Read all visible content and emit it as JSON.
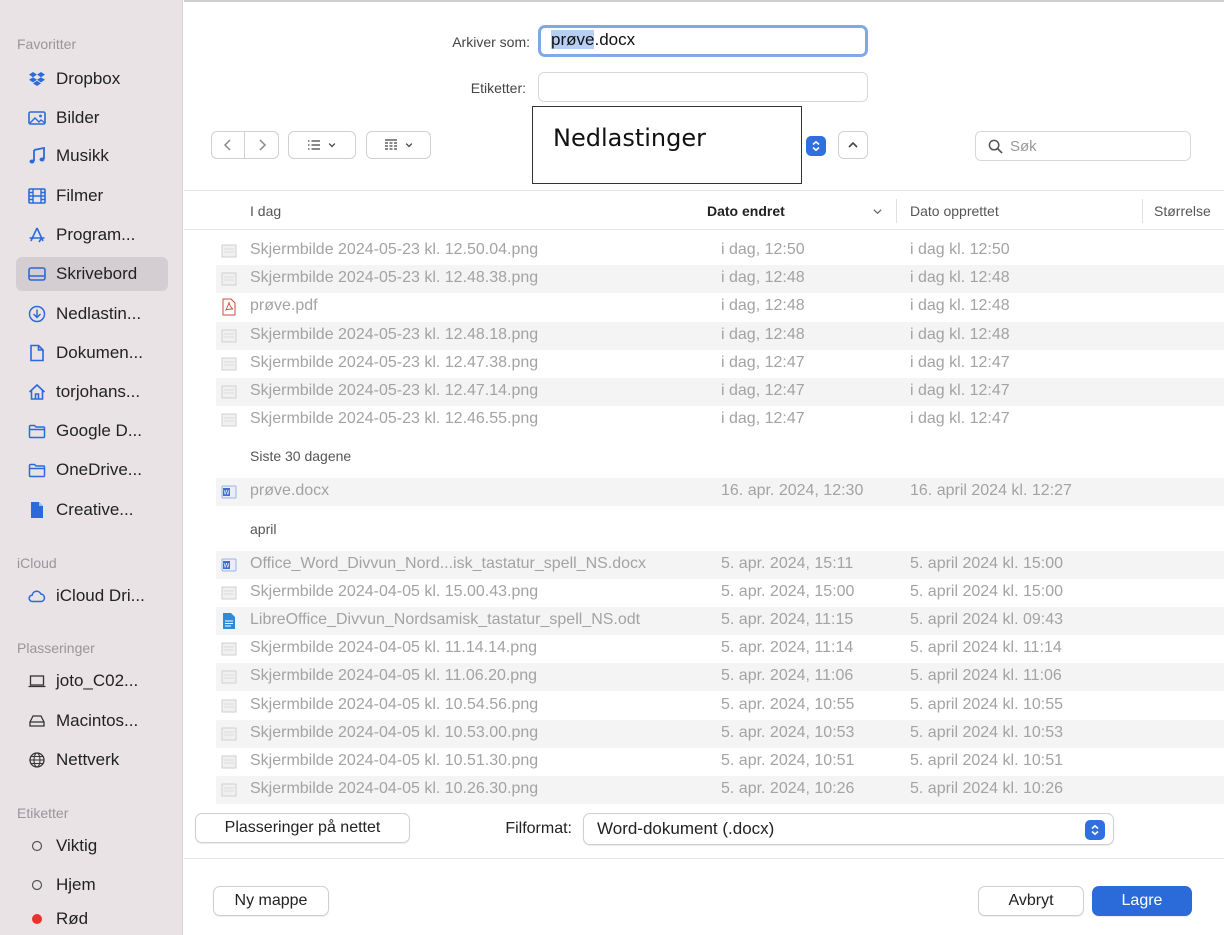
{
  "sidebar": {
    "sections": {
      "favorites": "Favoritter",
      "icloud": "iCloud",
      "locations": "Plasseringer",
      "tags": "Etiketter"
    },
    "favorites": [
      {
        "label": "Dropbox",
        "icon": "dropbox-icon"
      },
      {
        "label": "Bilder",
        "icon": "photos-icon"
      },
      {
        "label": "Musikk",
        "icon": "music-icon"
      },
      {
        "label": "Filmer",
        "icon": "film-icon"
      },
      {
        "label": "Program...",
        "icon": "applications-icon"
      },
      {
        "label": "Skrivebord",
        "icon": "desktop-icon",
        "selected": true
      },
      {
        "label": "Nedlastin...",
        "icon": "downloads-icon"
      },
      {
        "label": "Dokumen...",
        "icon": "document-icon"
      },
      {
        "label": "torjohans...",
        "icon": "home-icon"
      },
      {
        "label": "Google D...",
        "icon": "folder-icon"
      },
      {
        "label": "OneDrive...",
        "icon": "folder-icon"
      },
      {
        "label": "Creative...",
        "icon": "file-icon"
      }
    ],
    "icloud": [
      {
        "label": "iCloud Dri...",
        "icon": "cloud-icon"
      }
    ],
    "locations": [
      {
        "label": "joto_C02...",
        "icon": "laptop-icon"
      },
      {
        "label": "Macintos...",
        "icon": "disk-icon"
      },
      {
        "label": "Nettverk",
        "icon": "globe-icon"
      }
    ],
    "tags": [
      {
        "label": "Viktig",
        "color": ""
      },
      {
        "label": "Hjem",
        "color": ""
      },
      {
        "label": "Rød",
        "color": "#e8322b"
      }
    ]
  },
  "form": {
    "save_as_label": "Arkiver som:",
    "filename_selected": "prøve",
    "filename_ext": ".docx",
    "tags_label": "Etiketter:",
    "tags_value": ""
  },
  "toolbar": {
    "location": "Nedlastinger",
    "search_placeholder": "Søk"
  },
  "table": {
    "columns": {
      "name": "I dag",
      "modified": "Dato endret",
      "created": "Dato opprettet",
      "size": "Størrelse"
    },
    "groups": [
      {
        "title": "",
        "rows": [
          {
            "name": "Skjermbilde 2024-05-23 kl. 12.50.04.png",
            "modified": "i dag, 12:50",
            "created": "i dag kl. 12:50",
            "icon": "image-file-icon"
          },
          {
            "name": "Skjermbilde 2024-05-23 kl. 12.48.38.png",
            "modified": "i dag, 12:48",
            "created": "i dag kl. 12:48",
            "icon": "image-file-icon"
          },
          {
            "name": "prøve.pdf",
            "modified": "i dag, 12:48",
            "created": "i dag kl. 12:48",
            "icon": "pdf-file-icon"
          },
          {
            "name": "Skjermbilde 2024-05-23 kl. 12.48.18.png",
            "modified": "i dag, 12:48",
            "created": "i dag kl. 12:48",
            "icon": "image-file-icon"
          },
          {
            "name": "Skjermbilde 2024-05-23 kl. 12.47.38.png",
            "modified": "i dag, 12:47",
            "created": "i dag kl. 12:47",
            "icon": "image-file-icon"
          },
          {
            "name": "Skjermbilde 2024-05-23 kl. 12.47.14.png",
            "modified": "i dag, 12:47",
            "created": "i dag kl. 12:47",
            "icon": "image-file-icon"
          },
          {
            "name": "Skjermbilde 2024-05-23 kl. 12.46.55.png",
            "modified": "i dag, 12:47",
            "created": "i dag kl. 12:47",
            "icon": "image-file-icon"
          }
        ]
      },
      {
        "title": "Siste 30 dagene",
        "rows": [
          {
            "name": "prøve.docx",
            "modified": "16. apr. 2024, 12:30",
            "created": "16. april 2024 kl. 12:27",
            "icon": "word-file-icon"
          }
        ]
      },
      {
        "title": "april",
        "rows": [
          {
            "name": "Office_Word_Divvun_Nord...isk_tastatur_spell_NS.docx",
            "modified": "5. apr. 2024, 15:11",
            "created": "5. april 2024 kl. 15:00",
            "icon": "word-file-icon"
          },
          {
            "name": "Skjermbilde 2024-04-05 kl. 15.00.43.png",
            "modified": "5. apr. 2024, 15:00",
            "created": "5. april 2024 kl. 15:00",
            "icon": "image-file-icon"
          },
          {
            "name": "LibreOffice_Divvun_Nordsamisk_tastatur_spell_NS.odt",
            "modified": "5. apr. 2024, 11:15",
            "created": "5. april 2024 kl. 09:43",
            "icon": "odt-file-icon"
          },
          {
            "name": "Skjermbilde 2024-04-05 kl. 11.14.14.png",
            "modified": "5. apr. 2024, 11:14",
            "created": "5. april 2024 kl. 11:14",
            "icon": "image-file-icon"
          },
          {
            "name": "Skjermbilde 2024-04-05 kl. 11.06.20.png",
            "modified": "5. apr. 2024, 11:06",
            "created": "5. april 2024 kl. 11:06",
            "icon": "image-file-icon"
          },
          {
            "name": "Skjermbilde 2024-04-05 kl. 10.54.56.png",
            "modified": "5. apr. 2024, 10:55",
            "created": "5. april 2024 kl. 10:55",
            "icon": "image-file-icon"
          },
          {
            "name": "Skjermbilde 2024-04-05 kl. 10.53.00.png",
            "modified": "5. apr. 2024, 10:53",
            "created": "5. april 2024 kl. 10:53",
            "icon": "image-file-icon"
          },
          {
            "name": "Skjermbilde 2024-04-05 kl. 10.51.30.png",
            "modified": "5. apr. 2024, 10:51",
            "created": "5. april 2024 kl. 10:51",
            "icon": "image-file-icon"
          },
          {
            "name": "Skjermbilde 2024-04-05 kl. 10.26.30.png",
            "modified": "5. apr. 2024, 10:26",
            "created": "5. april 2024 kl. 10:26",
            "icon": "image-file-icon"
          }
        ]
      }
    ]
  },
  "bottom": {
    "online_locations_button": "Plasseringer på nettet",
    "format_label": "Filformat:",
    "format_value": "Word-dokument (.docx)",
    "new_folder_button": "Ny mappe",
    "cancel_button": "Avbryt",
    "save_button": "Lagre"
  },
  "colors": {
    "accent": "#2a6ad9",
    "sidebar_bg": "#e9e3e6",
    "selection": "#b6cff3"
  }
}
